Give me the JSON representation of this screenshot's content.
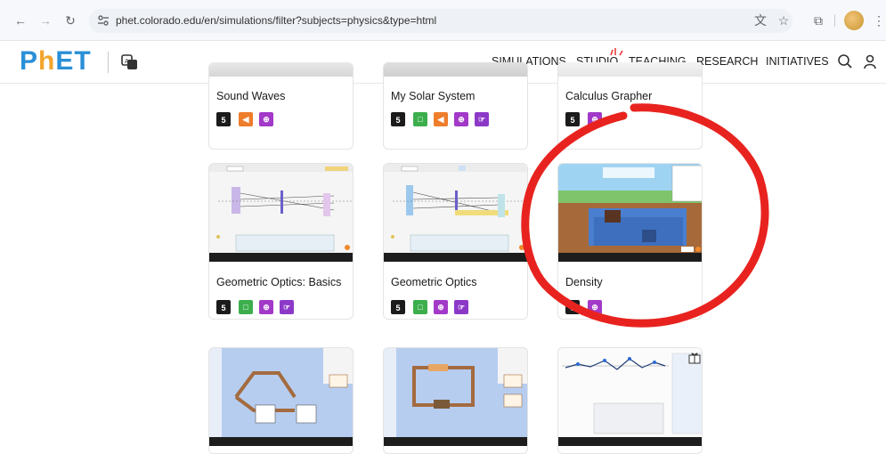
{
  "browser": {
    "url": "phet.colorado.edu/en/simulations/filter?subjects=physics&type=html"
  },
  "header": {
    "logo_p": "P",
    "logo_h": "h",
    "logo_et": "ET",
    "nav": [
      "SIMULATIONS",
      "STUDIO",
      "TEACHING",
      "RESEARCH",
      "INITIATIVES"
    ]
  },
  "cards": [
    {
      "title": "Sound Waves",
      "badges": [
        "html5",
        "flash",
        "interactive"
      ]
    },
    {
      "title": "My Solar System",
      "badges": [
        "html5",
        "java",
        "flash",
        "interactive",
        "touch"
      ]
    },
    {
      "title": "Calculus Grapher",
      "badges": [
        "html5",
        "interactive"
      ]
    },
    {
      "title": "Geometric Optics: Basics",
      "badges": [
        "html5",
        "java",
        "interactive",
        "touch"
      ]
    },
    {
      "title": "Geometric Optics",
      "badges": [
        "html5",
        "java",
        "interactive",
        "touch"
      ]
    },
    {
      "title": "Density",
      "badges": [
        "html5",
        "interactive"
      ]
    }
  ],
  "colors": {
    "annotation": "#e8231f",
    "phet_blue": "#2a8fd7",
    "phet_orange": "#f2a52b"
  }
}
